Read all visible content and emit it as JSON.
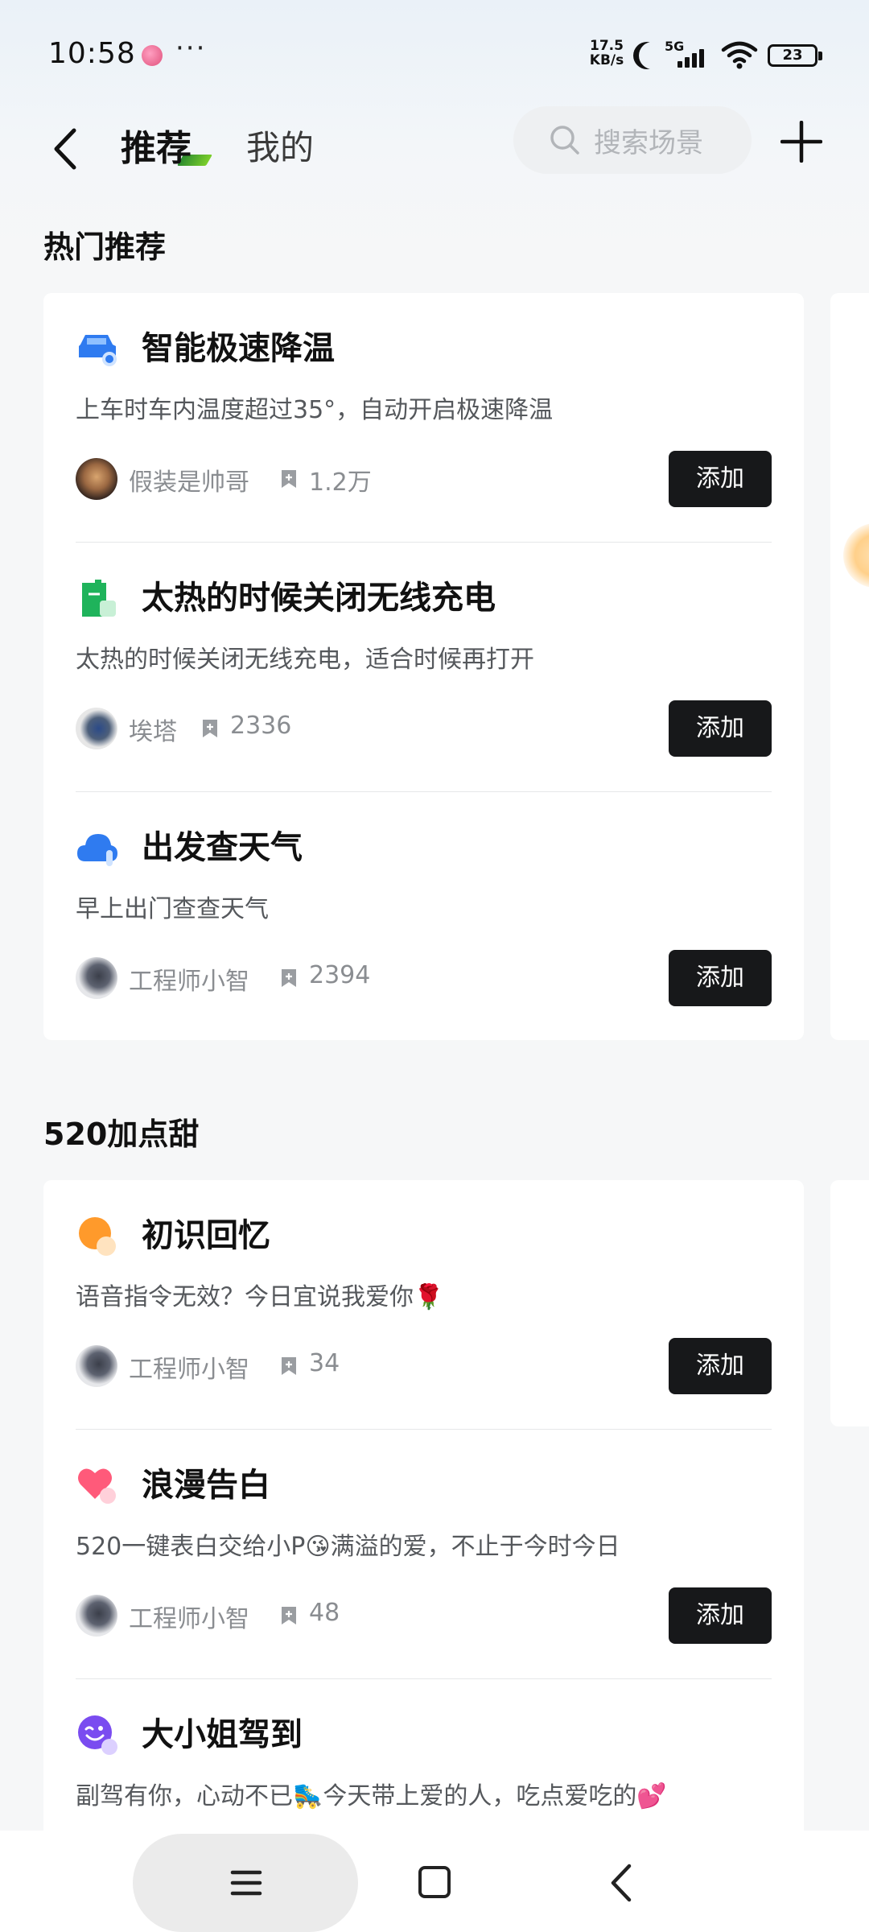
{
  "status_bar": {
    "time": "10:58",
    "more": "···",
    "speed_value": "17.5",
    "speed_unit": "KB/s",
    "network": "5G",
    "battery": "23"
  },
  "nav": {
    "tab_recommend": "推荐",
    "tab_mine": "我的",
    "search_placeholder": "搜索场景"
  },
  "sections": [
    {
      "title": "热门推荐",
      "items": [
        {
          "title": "智能极速降温",
          "desc": "上车时车内温度超过35°，自动开启极速降温",
          "author": "假装是帅哥",
          "count": "1.2万",
          "button": "添加",
          "icon": "car-icon",
          "icon_color": "#2f7bf0"
        },
        {
          "title": "太热的时候关闭无线充电",
          "desc": "太热的时候关闭无线充电，适合时候再打开",
          "author": "埃塔",
          "count": "2336",
          "button": "添加",
          "icon": "charger-icon",
          "icon_color": "#1fb35b"
        },
        {
          "title": "出发查天气",
          "desc": "早上出门查查天气",
          "author": "工程师小智",
          "count": "2394",
          "button": "添加",
          "icon": "cloud-icon",
          "icon_color": "#2f7bf0"
        }
      ]
    },
    {
      "title": "520加点甜",
      "items": [
        {
          "title": "初识回忆",
          "desc": "语音指令无效？今日宜说我爱你🌹",
          "author": "工程师小智",
          "count": "34",
          "button": "添加",
          "icon": "sun-icon",
          "icon_color": "#ff9a2b"
        },
        {
          "title": "浪漫告白",
          "desc": "520一键表白交给小P😘满溢的爱，不止于今时今日",
          "author": "工程师小智",
          "count": "48",
          "button": "添加",
          "icon": "heart-icon",
          "icon_color": "#ff5a7a"
        },
        {
          "title": "大小姐驾到",
          "desc": "副驾有你，心动不已🛼今天带上爱的人，吃点爱吃的💕",
          "icon": "wink-face-icon",
          "icon_color": "#7a4cf0"
        }
      ]
    }
  ]
}
